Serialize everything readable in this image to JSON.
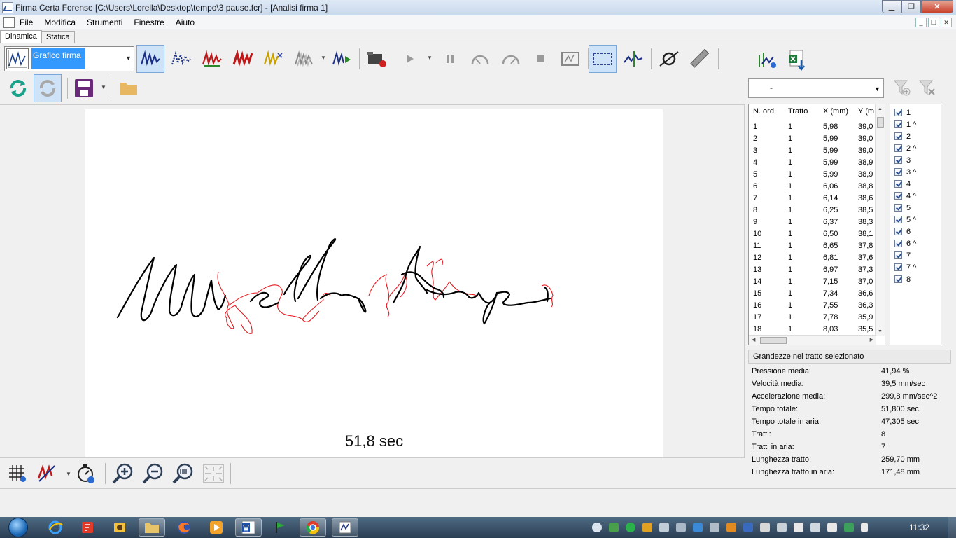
{
  "window": {
    "title": "Firma Certa Forense [C:\\Users\\Lorella\\Desktop\\tempo\\3 pause.fcr] - [Analisi firma 1]",
    "minimize": "▁",
    "maximize": "❐",
    "close": "✕"
  },
  "menu": [
    "File",
    "Modifica",
    "Strumenti",
    "Finestre",
    "Aiuto"
  ],
  "mdi": {
    "minimize": "_",
    "restore": "❐",
    "close": "✕"
  },
  "tabs": [
    {
      "label": "Dinamica",
      "active": true
    },
    {
      "label": "Statica",
      "active": false
    }
  ],
  "toolbar": {
    "graph_combo_value": "Grafico firma"
  },
  "canvas": {
    "time_label": "51,8 sec",
    "ink_color": "#000000",
    "air_color": "#e8191f"
  },
  "right_panel": {
    "stroke_filter_value": "-",
    "grid": {
      "columns": [
        "N. ord.",
        "Tratto",
        "X (mm)",
        "Y (m"
      ],
      "rows": [
        [
          "1",
          "1",
          "5,98",
          "39,0"
        ],
        [
          "2",
          "1",
          "5,99",
          "39,0"
        ],
        [
          "3",
          "1",
          "5,99",
          "39,0"
        ],
        [
          "4",
          "1",
          "5,99",
          "38,9"
        ],
        [
          "5",
          "1",
          "5,99",
          "38,9"
        ],
        [
          "6",
          "1",
          "6,06",
          "38,8"
        ],
        [
          "7",
          "1",
          "6,14",
          "38,6"
        ],
        [
          "8",
          "1",
          "6,25",
          "38,5"
        ],
        [
          "9",
          "1",
          "6,37",
          "38,3"
        ],
        [
          "10",
          "1",
          "6,50",
          "38,1"
        ],
        [
          "11",
          "1",
          "6,65",
          "37,8"
        ],
        [
          "12",
          "1",
          "6,81",
          "37,6"
        ],
        [
          "13",
          "1",
          "6,97",
          "37,3"
        ],
        [
          "14",
          "1",
          "7,15",
          "37,0"
        ],
        [
          "15",
          "1",
          "7,34",
          "36,6"
        ],
        [
          "16",
          "1",
          "7,55",
          "36,3"
        ],
        [
          "17",
          "1",
          "7,78",
          "35,9"
        ],
        [
          "18",
          "1",
          "8,03",
          "35,5"
        ]
      ]
    },
    "strokes": [
      "1",
      "1 ^",
      "2",
      "2 ^",
      "3",
      "3 ^",
      "4",
      "4 ^",
      "5",
      "5 ^",
      "6",
      "6 ^",
      "7",
      "7 ^",
      "8"
    ],
    "stats_header": "Grandezze nel tratto selezionato",
    "stats": [
      {
        "label": "Pressione media:",
        "value": "41,94 %"
      },
      {
        "label": "Velocità media:",
        "value": "39,5 mm/sec"
      },
      {
        "label": "Accelerazione media:",
        "value": "299,8 mm/sec^2"
      },
      {
        "label": "Tempo totale:",
        "value": "51,800 sec"
      },
      {
        "label": "Tempo totale in aria:",
        "value": "47,305 sec"
      },
      {
        "label": "Tratti:",
        "value": "8"
      },
      {
        "label": "Tratti in aria:",
        "value": "7"
      },
      {
        "label": "Lunghezza tratto:",
        "value": "259,70 mm"
      },
      {
        "label": "Lunghezza tratto in aria:",
        "value": "171,48 mm"
      }
    ]
  },
  "taskbar": {
    "clock": "11:32",
    "apps": [
      "internet-explorer",
      "foxit-reader",
      "media-center",
      "file-explorer",
      "firefox",
      "media-player",
      "word",
      "green-flag-app",
      "chrome",
      "firma-certa-forense"
    ]
  }
}
